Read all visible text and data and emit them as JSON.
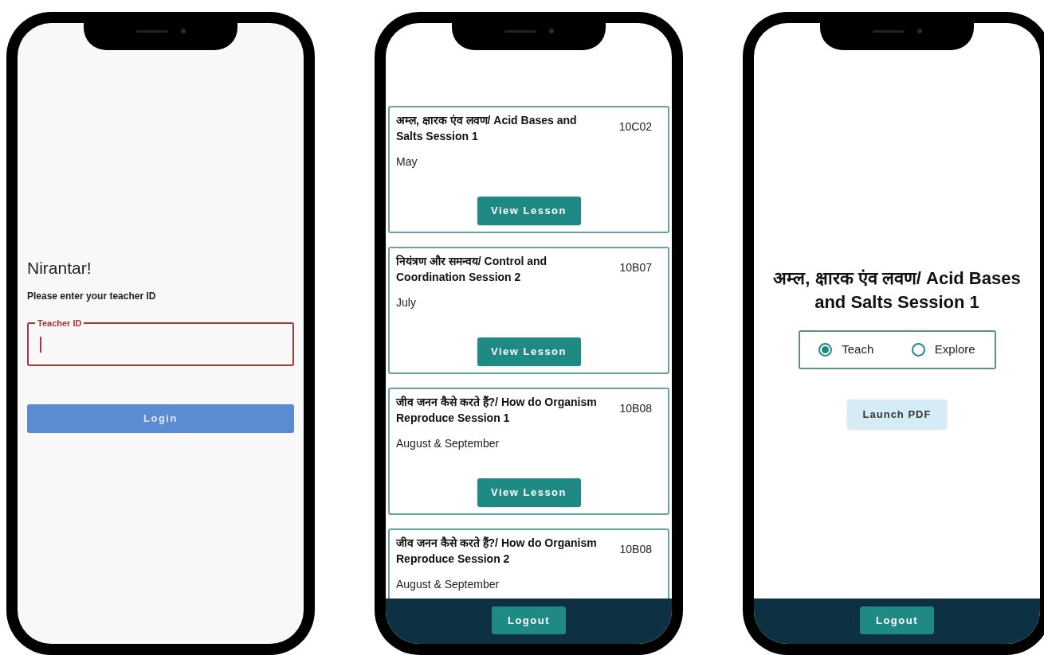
{
  "screens": [
    {
      "kind": "login",
      "title": "Nirantar!",
      "prompt": "Please enter your teacher ID",
      "field": {
        "label": "Teacher ID",
        "focused": true
      },
      "button": {
        "label": "Login",
        "disabled": true
      }
    },
    {
      "kind": "lessons",
      "lessons": [
        {
          "title": "अम्ल, क्षारक एंव लवण/ Acid Bases and Salts Session 1",
          "code": "10C02",
          "month": "May",
          "button": "View Lesson"
        },
        {
          "title": "नियंत्रण और समन्वय/ Control and Coordination Session 2",
          "code": "10B07",
          "month": "July",
          "button": "View Lesson"
        },
        {
          "title": "जीव जनन कैसे करते हैं?/ How do Organism Reproduce Session 1",
          "code": "10B08",
          "month": "August & September",
          "button": "View Lesson"
        },
        {
          "title": "जीव जनन कैसे करते हैं?/ How do Organism Reproduce Session 2",
          "code": "10B08",
          "month": "August & September"
        }
      ],
      "footer_button": "Logout"
    },
    {
      "kind": "lesson_detail",
      "title": "अम्ल, क्षारक एंव लवण/ Acid Bases and Salts Session 1",
      "modes": [
        {
          "label": "Teach",
          "selected": true
        },
        {
          "label": "Explore",
          "selected": false
        }
      ],
      "button": "Launch PDF",
      "footer_button": "Logout"
    }
  ]
}
